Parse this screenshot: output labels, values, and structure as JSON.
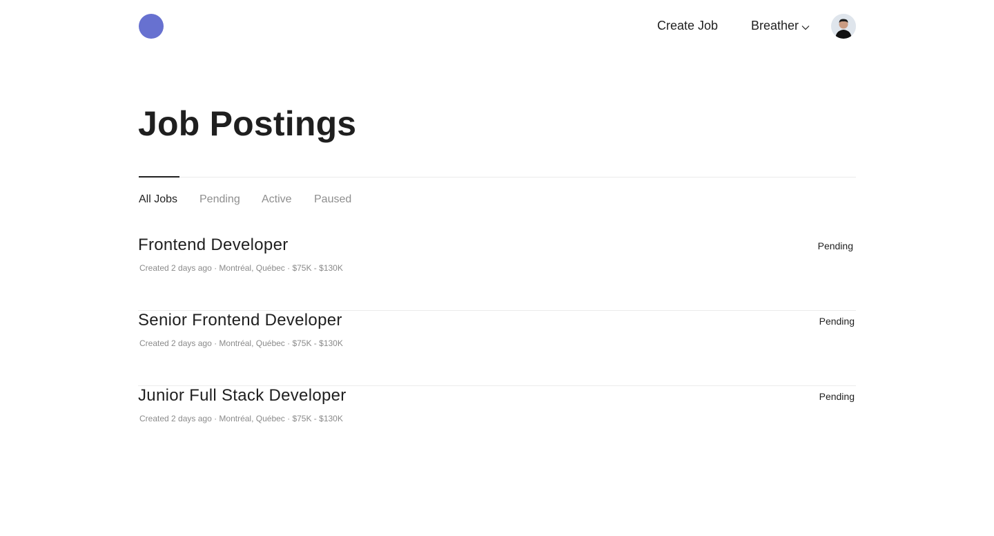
{
  "theme": {
    "accent": "#6771d0"
  },
  "header": {
    "logo_icon": "circle-logo",
    "create_job_label": "Create Job",
    "org_label": "Breather",
    "org_chevron_icon": "chevron-down-icon",
    "avatar_icon": "user-avatar"
  },
  "page": {
    "title": "Job Postings"
  },
  "tabs": [
    {
      "label": "All Jobs",
      "active": true
    },
    {
      "label": "Pending",
      "active": false
    },
    {
      "label": "Active",
      "active": false
    },
    {
      "label": "Paused",
      "active": false
    }
  ],
  "jobs": [
    {
      "title": "Frontend Developer",
      "meta": "Created 2 days ago · Montréal, Québec · $75K - $130K",
      "status": "Pending"
    },
    {
      "title": "Senior Frontend Developer",
      "meta": "Created 2 days ago · Montréal, Québec · $75K - $130K",
      "status": "Pending"
    },
    {
      "title": "Junior Full Stack Developer",
      "meta": "Created 2 days ago · Montréal, Québec · $75K - $130K",
      "status": "Pending"
    }
  ]
}
